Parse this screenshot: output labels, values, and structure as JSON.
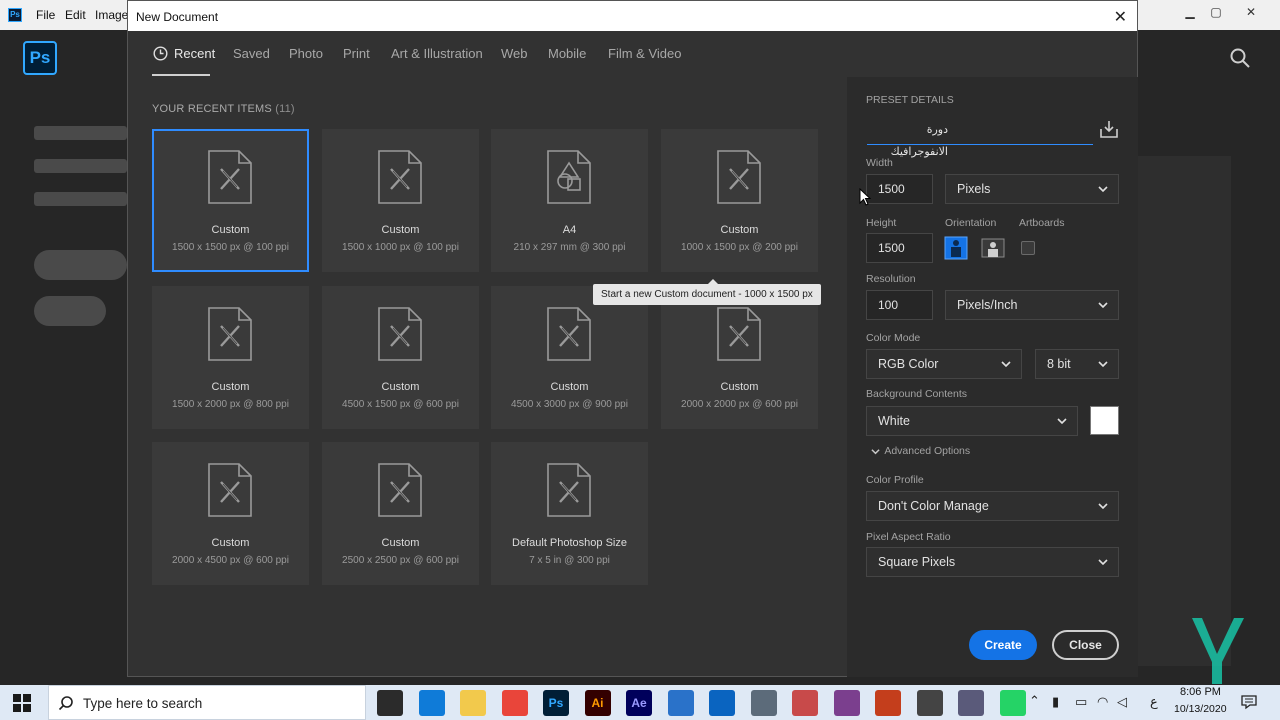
{
  "ps_window": {
    "menu": [
      "File",
      "Edit",
      "Image"
    ],
    "logo_text": "Ps",
    "mini_logo": "Ps"
  },
  "dialog": {
    "title": "New Document",
    "close_glyph": "✕",
    "tabs": [
      "Recent",
      "Saved",
      "Photo",
      "Print",
      "Art & Illustration",
      "Web",
      "Mobile",
      "Film & Video"
    ],
    "active_tab": "Recent",
    "recent_label": "YOUR RECENT ITEMS",
    "recent_count": "(11)",
    "items": [
      {
        "name": "Custom",
        "dims": "1500 x 1500 px @ 100 ppi",
        "icon": "document-x-icon",
        "selected": true
      },
      {
        "name": "Custom",
        "dims": "1500 x 1000 px @ 100 ppi",
        "icon": "document-x-icon"
      },
      {
        "name": "A4",
        "dims": "210 x 297 mm @ 300 ppi",
        "icon": "document-shapes-icon"
      },
      {
        "name": "Custom",
        "dims": "1000 x 1500 px @ 200 ppi",
        "icon": "document-x-icon"
      },
      {
        "name": "Custom",
        "dims": "1500 x 2000 px @ 800 ppi",
        "icon": "document-x-icon"
      },
      {
        "name": "Custom",
        "dims": "4500 x 1500 px @ 600 ppi",
        "icon": "document-x-icon"
      },
      {
        "name": "Custom",
        "dims": "4500 x 3000 px @ 900 ppi",
        "icon": "document-x-icon"
      },
      {
        "name": "Custom",
        "dims": "2000 x 2000 px @ 600 ppi",
        "icon": "document-x-icon"
      },
      {
        "name": "Custom",
        "dims": "2000 x 4500 px @ 600 ppi",
        "icon": "document-x-icon"
      },
      {
        "name": "Custom",
        "dims": "2500 x 2500 px @ 600 ppi",
        "icon": "document-x-icon"
      },
      {
        "name": "Default Photoshop Size",
        "dims": "7 x 5 in @ 300 ppi",
        "icon": "document-x-icon"
      }
    ],
    "tooltip": "Start a new Custom document - 1000 x 1500 px",
    "preset": {
      "section_label": "PRESET DETAILS",
      "name": "دورة الانفوجرافيك",
      "width_label": "Width",
      "width_value": "1500",
      "width_unit": "Pixels",
      "height_label": "Height",
      "height_value": "1500",
      "orientation_label": "Orientation",
      "artboards_label": "Artboards",
      "orientation_selected": "portrait",
      "artboards_checked": false,
      "resolution_label": "Resolution",
      "resolution_value": "100",
      "resolution_unit": "Pixels/Inch",
      "color_mode_label": "Color Mode",
      "color_mode": "RGB Color",
      "bit_depth": "8 bit",
      "bg_label": "Background Contents",
      "bg_value": "White",
      "bg_swatch_color": "#ffffff",
      "advanced_label": "Advanced Options",
      "color_profile_label": "Color Profile",
      "color_profile": "Don't Color Manage",
      "pixel_aspect_label": "Pixel Aspect Ratio",
      "pixel_aspect": "Square Pixels",
      "create_label": "Create",
      "close_label": "Close"
    }
  },
  "taskbar": {
    "search_placeholder": "Type here to search",
    "time": "8:06 PM",
    "date": "10/13/2020",
    "lang": "ع",
    "apps": [
      {
        "name": "store-app-icon",
        "label": "",
        "color": "#2b2b2b"
      },
      {
        "name": "edge-app-icon",
        "label": "",
        "color": "#0f7bd8"
      },
      {
        "name": "file-explorer-app-icon",
        "label": "",
        "color": "#f2c94c"
      },
      {
        "name": "chrome-app-icon",
        "label": "",
        "color": "#e9453a"
      },
      {
        "name": "photoshop-app-icon",
        "label": "Ps",
        "color": "#001e36"
      },
      {
        "name": "illustrator-app-icon",
        "label": "Ai",
        "color": "#330000"
      },
      {
        "name": "after-effects-app-icon",
        "label": "Ae",
        "color": "#00005b"
      },
      {
        "name": "mail-app-icon",
        "label": "",
        "color": "#2a72c9"
      },
      {
        "name": "outlook-app-icon",
        "label": "",
        "color": "#0a64c0"
      },
      {
        "name": "calculator-app-icon",
        "label": "",
        "color": "#5c6b7a"
      },
      {
        "name": "snipping-app-icon",
        "label": "",
        "color": "#c84a4a"
      },
      {
        "name": "winrar-app-icon",
        "label": "",
        "color": "#7b3f8e"
      },
      {
        "name": "powerpoint-app-icon",
        "label": "",
        "color": "#c43e1c"
      },
      {
        "name": "settings-app-icon",
        "label": "",
        "color": "#444444"
      },
      {
        "name": "media-app-icon",
        "label": "",
        "color": "#5a5a7a"
      },
      {
        "name": "whatsapp-app-icon",
        "label": "",
        "color": "#25d366"
      }
    ]
  },
  "colors": {
    "accent": "#1473e6",
    "selection": "#2f8cff",
    "dialog_bg": "#323232",
    "panel_bg": "#2b2b2b"
  }
}
